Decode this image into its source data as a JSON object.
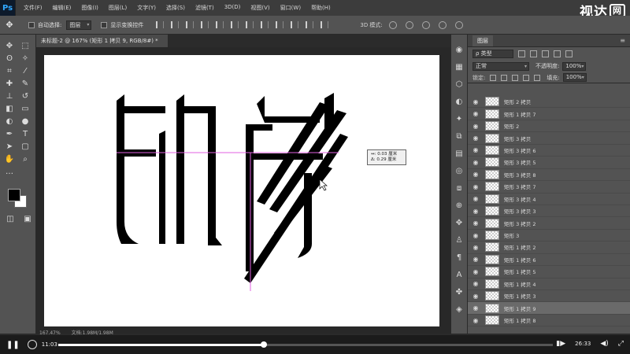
{
  "app": {
    "logo": "Ps"
  },
  "menu": [
    "文件(F)",
    "编辑(E)",
    "图像(I)",
    "图层(L)",
    "文字(Y)",
    "选择(S)",
    "滤镜(T)",
    "3D(D)",
    "视图(V)",
    "窗口(W)",
    "帮助(H)"
  ],
  "watermark": {
    "text": "视达",
    "box": "网"
  },
  "options": {
    "auto_select_label": "自动选择:",
    "auto_select_value": "图层",
    "show_transform_label": "显示变换控件",
    "mode3d_label": "3D 模式:"
  },
  "document": {
    "tab_title": "未标题-2 @ 167% (矩形 1 拷贝 9, RGB/8#) *",
    "status_zoom": "167.47%",
    "status_doc": "文档:1.98M/1.98M"
  },
  "canvas_tooltip": {
    "line1": "↔: 0.03 厘米",
    "line2": "Δ: 0.29 厘米"
  },
  "layers_panel": {
    "tab": "图层",
    "filter_kind": "ρ 类型",
    "blend_mode": "正常",
    "opacity_label": "不透明度:",
    "opacity_value": "100%",
    "lock_label": "锁定:",
    "fill_label": "填充:",
    "fill_value": "100%",
    "layers": [
      "矩形 2 拷贝",
      "矩形 1 拷贝 7",
      "矩形 2",
      "矩形 3 拷贝",
      "矩形 3 拷贝 6",
      "矩形 3 拷贝 5",
      "矩形 3 拷贝 8",
      "矩形 3 拷贝 7",
      "矩形 3 拷贝 4",
      "矩形 3 拷贝 3",
      "矩形 3 拷贝 2",
      "矩形 3",
      "矩形 1 拷贝 2",
      "矩形 1 拷贝 6",
      "矩形 1 拷贝 5",
      "矩形 1 拷贝 4",
      "矩形 1 拷贝 3",
      "矩形 1 拷贝 9",
      "矩形 1 拷贝 8"
    ],
    "selected_index": 17
  },
  "video": {
    "current_time": "11:03",
    "total_time": "26:33",
    "progress": 0.416
  }
}
